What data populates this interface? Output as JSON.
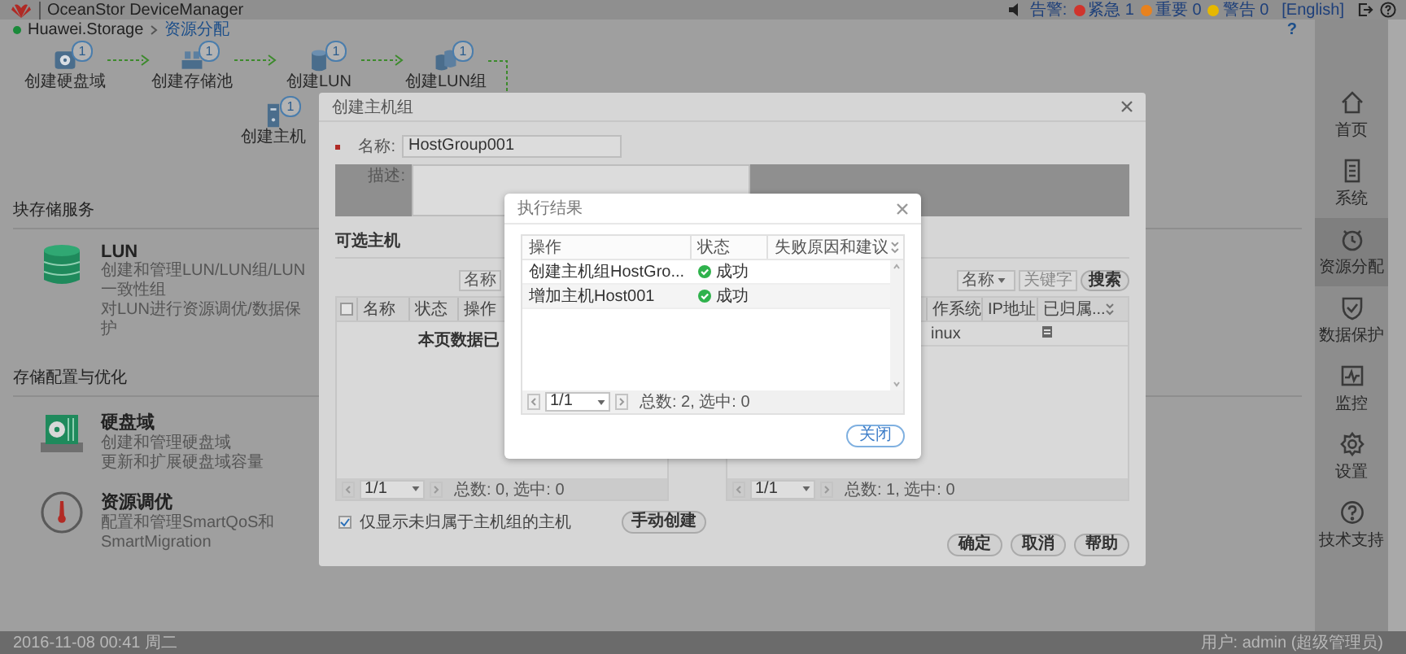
{
  "top_bar": {
    "title": "OceanStor DeviceManager",
    "alarm_label": "告警:",
    "alarms": [
      {
        "label": "紧急 1",
        "color": "#d0342c"
      },
      {
        "label": "重要 0",
        "color": "#e8821e"
      },
      {
        "label": "警告 0",
        "color": "#e6b800"
      }
    ],
    "language": "[English]"
  },
  "breadcrumb": {
    "items": [
      "Huawei.Storage",
      "资源分配"
    ],
    "help": "?"
  },
  "workflow": {
    "steps": [
      {
        "kind": "disk-domain",
        "label": "创建硬盘域",
        "badge": "1"
      },
      {
        "kind": "pool",
        "label": "创建存储池",
        "badge": "1"
      },
      {
        "kind": "lun",
        "label": "创建LUN",
        "badge": "1"
      },
      {
        "kind": "lun-group",
        "label": "创建LUN组",
        "badge": "1"
      }
    ],
    "branch": {
      "kind": "host",
      "label": "创建主机",
      "badge": "1"
    }
  },
  "sections": [
    {
      "title": "块存储服务",
      "cards": [
        {
          "kind": "lun",
          "title": "LUN",
          "lines": [
            "创建和管理LUN/LUN组/LUN一致性组",
            "对LUN进行资源调优/数据保护"
          ]
        }
      ]
    },
    {
      "title": "存储配置与优化",
      "cards": [
        {
          "kind": "disk-domain",
          "title": "硬盘域",
          "lines": [
            "创建和管理硬盘域",
            "更新和扩展硬盘域容量"
          ]
        },
        {
          "kind": "tuning",
          "title": "资源调优",
          "lines": [
            "配置和管理SmartQoS和SmartMigration"
          ]
        }
      ]
    }
  ],
  "nav": [
    {
      "kind": "home",
      "label": "首页",
      "selected": false
    },
    {
      "kind": "system",
      "label": "系统",
      "selected": false
    },
    {
      "kind": "provision",
      "label": "资源分配",
      "selected": true
    },
    {
      "kind": "protection",
      "label": "数据保护",
      "selected": false
    },
    {
      "kind": "monitor",
      "label": "监控",
      "selected": false
    },
    {
      "kind": "settings",
      "label": "设置",
      "selected": false
    },
    {
      "kind": "support",
      "label": "技术支持",
      "selected": false
    }
  ],
  "status_bar": {
    "datetime": "2016-11-08 00:41 周二",
    "user": "用户: admin (超级管理员)"
  },
  "create_dialog": {
    "title": "创建主机组",
    "name_label": "名称:",
    "name_value": "HostGroup001",
    "description_label": "描述:",
    "section_title": "可选主机",
    "available": {
      "search_field": "名称",
      "select_all_checked": false,
      "columns": [
        "名称",
        "状态",
        "操作"
      ],
      "empty_message": "本页数据已",
      "page": "1/1",
      "summary": "总数: 0, 选中: 0"
    },
    "selected_hosts": {
      "search_by": "名称",
      "search_placeholder": "关键字",
      "search_button": "搜索",
      "columns": [
        "作系统",
        "IP地址",
        "已归属..."
      ],
      "rows": [
        {
          "os": "inux"
        }
      ],
      "page": "1/1",
      "summary": "总数: 1, 选中: 0"
    },
    "filter": {
      "label": "仅显示未归属于主机组的主机",
      "checked": true
    },
    "manual_button": "手动创建",
    "buttons": [
      "确定",
      "取消",
      "帮助"
    ]
  },
  "result_dialog": {
    "title": "执行结果",
    "columns": [
      "操作",
      "状态",
      "失败原因和建议"
    ],
    "rows": [
      {
        "operation": "创建主机组HostGro...",
        "status": "成功",
        "kind": "success"
      },
      {
        "operation": "增加主机Host001",
        "status": "成功",
        "kind": "success"
      }
    ],
    "page": "1/1",
    "summary": "总数: 2, 选中: 0",
    "close_button": "关闭"
  }
}
